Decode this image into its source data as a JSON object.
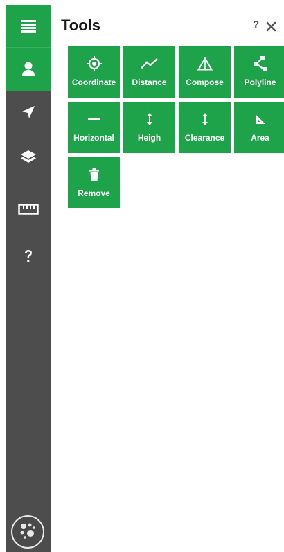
{
  "sidebar": {
    "items": [
      {
        "name": "menu",
        "icon": "hamburger-menu-icon"
      },
      {
        "name": "user",
        "icon": "user-icon"
      },
      {
        "name": "navigate",
        "icon": "navigation-arrow-icon"
      },
      {
        "name": "layers",
        "icon": "layers-icon"
      },
      {
        "name": "measure",
        "icon": "ruler-icon"
      },
      {
        "name": "help",
        "icon": "help-question-icon"
      }
    ],
    "active_color": "#1ea24a",
    "background_color": "#4d4d4d",
    "logo_icon": "logo-dots-icon"
  },
  "panel": {
    "title": "Tools",
    "help_label": "?",
    "close_icon": "close-icon"
  },
  "tools": [
    {
      "label": "Coordinate",
      "icon": "crosshair-icon"
    },
    {
      "label": "Distance",
      "icon": "line-graph-icon"
    },
    {
      "label": "Compose",
      "icon": "triangle-icon"
    },
    {
      "label": "Polyline",
      "icon": "polyline-icon"
    },
    {
      "label": "Horizontal",
      "icon": "horizontal-line-icon"
    },
    {
      "label": "Heigh",
      "icon": "vertical-arrows-icon"
    },
    {
      "label": "Clearance",
      "icon": "vertical-arrows-icon"
    },
    {
      "label": "Area",
      "icon": "set-square-icon"
    },
    {
      "label": "Remove",
      "icon": "trash-icon"
    }
  ],
  "tool_color": "#1ea24a"
}
